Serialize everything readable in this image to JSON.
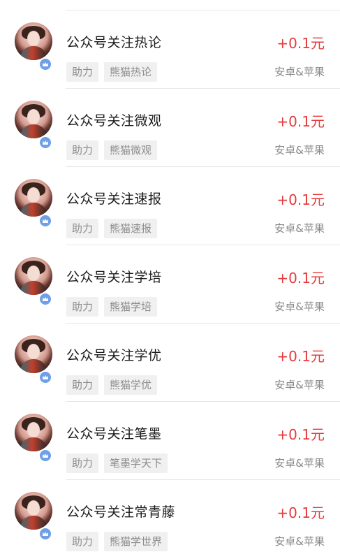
{
  "colors": {
    "price": "#e5393a",
    "badge": "#6f9fe6",
    "tag_bg": "#f0f0f0",
    "tag_text": "#8c8c8c"
  },
  "tasks": [
    {
      "title": "公众号关注热论",
      "price": "+0.1元",
      "tags": [
        "助力",
        "熊猫热论"
      ],
      "platform": "安卓&苹果",
      "avatar_icon": "user-avatar-icon",
      "badge_icon": "crown-badge-icon"
    },
    {
      "title": "公众号关注微观",
      "price": "+0.1元",
      "tags": [
        "助力",
        "熊猫微观"
      ],
      "platform": "安卓&苹果",
      "avatar_icon": "user-avatar-icon",
      "badge_icon": "crown-badge-icon"
    },
    {
      "title": "公众号关注速报",
      "price": "+0.1元",
      "tags": [
        "助力",
        "熊猫速报"
      ],
      "platform": "安卓&苹果",
      "avatar_icon": "user-avatar-icon",
      "badge_icon": "crown-badge-icon"
    },
    {
      "title": "公众号关注学培",
      "price": "+0.1元",
      "tags": [
        "助力",
        "熊猫学培"
      ],
      "platform": "安卓&苹果",
      "avatar_icon": "user-avatar-icon",
      "badge_icon": "crown-badge-icon"
    },
    {
      "title": "公众号关注学优",
      "price": "+0.1元",
      "tags": [
        "助力",
        "熊猫学优"
      ],
      "platform": "安卓&苹果",
      "avatar_icon": "user-avatar-icon",
      "badge_icon": "crown-badge-icon"
    },
    {
      "title": "公众号关注笔墨",
      "price": "+0.1元",
      "tags": [
        "助力",
        "笔墨学天下"
      ],
      "platform": "安卓&苹果",
      "avatar_icon": "user-avatar-icon",
      "badge_icon": "crown-badge-icon"
    },
    {
      "title": "公众号关注常青藤",
      "price": "+0.1元",
      "tags": [
        "助力",
        "熊猫学世界"
      ],
      "platform": "安卓&苹果",
      "avatar_icon": "user-avatar-icon",
      "badge_icon": "crown-badge-icon"
    }
  ]
}
